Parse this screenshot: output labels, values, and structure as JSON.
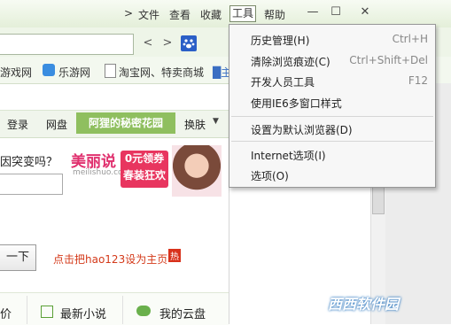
{
  "menubar": {
    "chevron": ">",
    "items": [
      "文件",
      "查看",
      "收藏",
      "工具",
      "帮助"
    ],
    "active": "工具",
    "window_buttons": [
      "—",
      "☐",
      "✕"
    ]
  },
  "address": {
    "nav": [
      "<",
      ">"
    ],
    "search_engine_icon": "baidu-paw-icon"
  },
  "favorites": {
    "items": [
      {
        "label": "游戏网",
        "icon": ""
      },
      {
        "label": "乐游网",
        "icon": "leyou-icon"
      },
      {
        "label": "淘宝网、特卖商城",
        "icon": "page-icon"
      },
      {
        "label": "█主",
        "icon": ""
      }
    ]
  },
  "page_header": {
    "login": "登录",
    "netdisk": "网盘",
    "garden": "阿狸的秘密花园",
    "skin": "换肤"
  },
  "content": {
    "question": "因突变吗？",
    "ad": {
      "brand": "美丽说",
      "site": "meilishuo.com",
      "coupon_line1": "0元领券",
      "coupon_line2": "春装狂欢"
    },
    "search_button": "一下",
    "homepage_link": "点击把hao123设为主页",
    "hot_badge": "热"
  },
  "bottom_tabs": [
    {
      "label": "价"
    },
    {
      "label": "最新小说",
      "icon": "book-icon"
    },
    {
      "label": "我的云盘",
      "icon": "cloud-icon"
    }
  ],
  "tools_menu": {
    "items": [
      {
        "label": "历史管理(H)",
        "shortcut": "Ctrl+H"
      },
      {
        "label": "清除浏览痕迹(C)",
        "shortcut": "Ctrl+Shift+Del"
      },
      {
        "label": "开发人员工具",
        "shortcut": "F12"
      },
      {
        "label": "使用IE6多窗口样式",
        "shortcut": ""
      },
      {
        "label": "设置为默认浏览器(D)",
        "shortcut": ""
      },
      {
        "label": "Internet选项(I)",
        "shortcut": ""
      },
      {
        "label": "选项(O)",
        "shortcut": ""
      }
    ]
  },
  "watermark": "西西软件园"
}
